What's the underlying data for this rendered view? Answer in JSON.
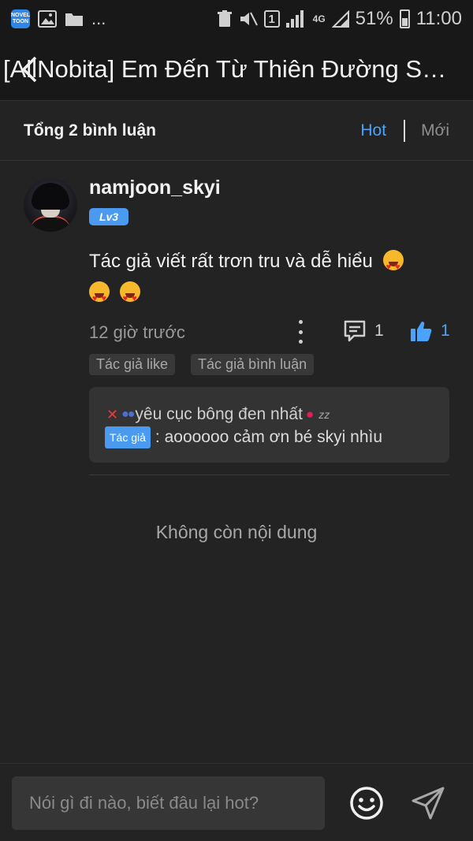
{
  "status_bar": {
    "app_icon_text": "NOVEL TOON",
    "ellipsis": "...",
    "sim_label": "1",
    "network_type": "4G",
    "battery": "51%",
    "time": "11:00"
  },
  "header": {
    "title": "[AllNobita] Em Đến Từ Thiên Đường S…"
  },
  "comments_bar": {
    "count_text": "Tổng 2 bình luận",
    "sort_hot": "Hot",
    "sort_new": "Mới"
  },
  "comment": {
    "username": "namjoon_skyi",
    "level": "Lv3",
    "text": "Tác giả viết rất trơn tru và dễ hiểu",
    "time": "12 giờ trước",
    "reply_count": "1",
    "like_count": "1",
    "tags": [
      "Tác giả like",
      "Tác giả bình luận"
    ],
    "reply": {
      "author_name": "yêu cục bông đen nhất",
      "author_badge": "Tác giả",
      "text": ": aoooooo cảm ơn bé skyi nhìu"
    }
  },
  "end_text": "Không còn nội dung",
  "input_bar": {
    "placeholder": "Nói gì đi nào, biết đâu lại hot?"
  },
  "colors": {
    "accent": "#4aa3ff",
    "background": "#232323",
    "header": "#181818"
  }
}
